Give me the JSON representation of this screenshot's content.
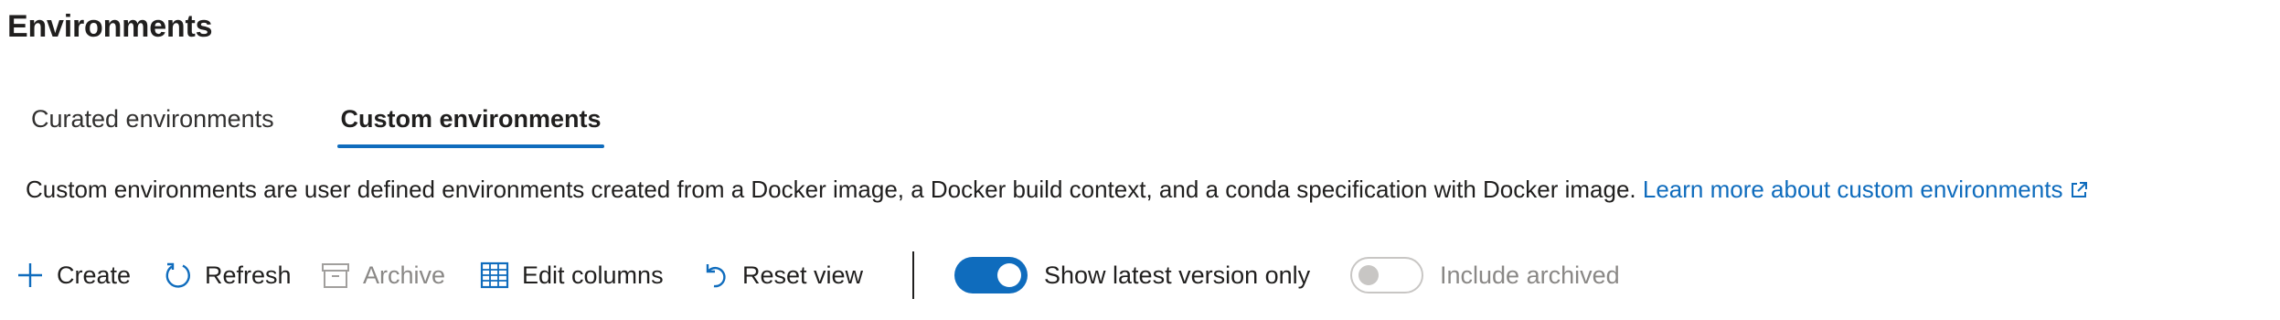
{
  "page": {
    "title": "Environments"
  },
  "tabs": [
    {
      "label": "Curated environments",
      "selected": false
    },
    {
      "label": "Custom environments",
      "selected": true
    }
  ],
  "description": {
    "text": "Custom environments are user defined environments created from a Docker image, a Docker build context, and a conda specification with Docker image.",
    "link_label": "Learn more about custom environments",
    "link_icon": "external-link-icon"
  },
  "toolbar": {
    "create_label": "Create",
    "refresh_label": "Refresh",
    "archive_label": "Archive",
    "archive_disabled": true,
    "edit_columns_label": "Edit columns",
    "reset_view_label": "Reset view",
    "show_latest_label": "Show latest version only",
    "show_latest_on": true,
    "include_archived_label": "Include archived",
    "include_archived_on": false,
    "include_archived_disabled": true
  },
  "colors": {
    "accent": "#0f6cbd",
    "text": "#201f1e",
    "disabled": "#8a8886"
  }
}
